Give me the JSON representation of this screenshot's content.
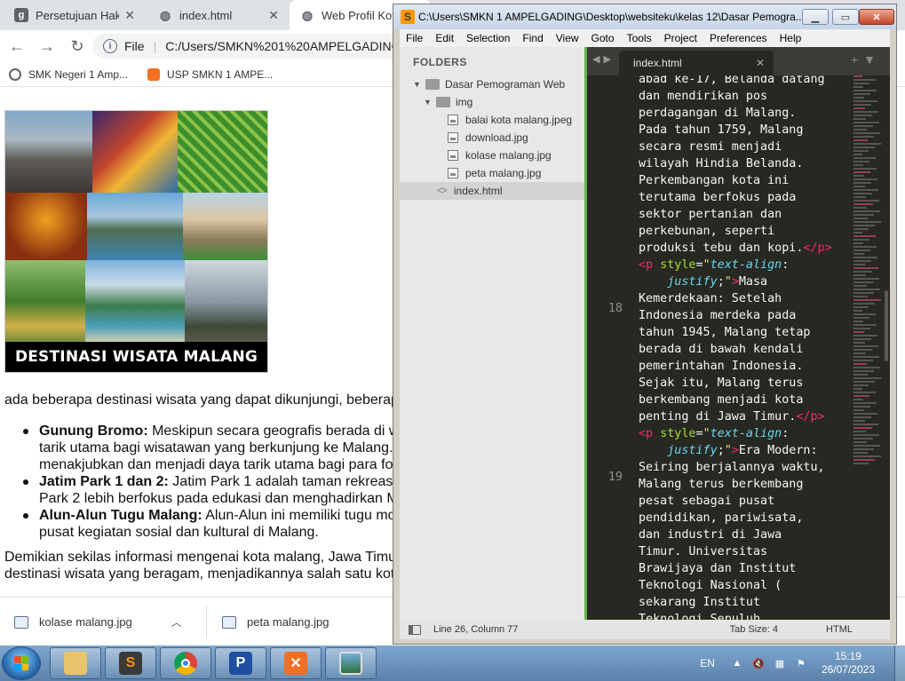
{
  "browser": {
    "tabs": [
      {
        "title": "Persetujuan Hak C",
        "favicon": "docs-icon",
        "color": "#5f6368",
        "active": false
      },
      {
        "title": "index.html",
        "favicon": "globe-icon",
        "color": "#5f6368",
        "active": false
      },
      {
        "title": "Web Profil Kota",
        "favicon": "globe-icon",
        "color": "#5f6368",
        "active": true
      }
    ],
    "address": {
      "prefix": "File",
      "url": "C:/Users/SMKN%201%20AMPELGADING/D"
    },
    "bookmarks": [
      {
        "label": "SMK Negeri 1 Amp...",
        "icon": "globe-icon"
      },
      {
        "label": "USP SMKN 1 AMPE...",
        "icon": "xampp-icon"
      }
    ]
  },
  "page": {
    "collage_caption": "DESTINASI WISATA MALANG",
    "intro": "ada beberapa destinasi wisata yang dapat dikunjungi, beberap",
    "destinations": [
      {
        "name": "Gunung Bromo:",
        "text": " Meskipun secara geografis berada di wi",
        "cont": [
          "tarik utama bagi wisatawan yang berkunjung ke Malang.",
          "menakjubkan dan menjadi daya tarik utama bagi para fo"
        ]
      },
      {
        "name": "Jatim Park 1 dan 2:",
        "text": " Jatim Park 1 adalah taman rekreas",
        "cont": [
          "Park 2 lebih berfokus pada edukasi dan menghadirkan M"
        ]
      },
      {
        "name": "Alun-Alun Tugu Malang:",
        "text": " Alun-Alun ini memiliki tugu mo",
        "cont": [
          "pusat kegiatan sosial dan kultural di Malang."
        ]
      }
    ],
    "outro": [
      "Demikian sekilas informasi mengenai kota malang, Jawa Timu",
      "destinasi wisata yang beragam, menjadikannya salah satu kot"
    ]
  },
  "downloads": [
    {
      "name": "kolase malang.jpg"
    },
    {
      "name": "peta malang.jpg"
    }
  ],
  "sublime": {
    "title": "C:\\Users\\SMKN 1 AMPELGADING\\Desktop\\websiteku\\kelas 12\\Dasar Pemogra...",
    "menu": [
      "File",
      "Edit",
      "Selection",
      "Find",
      "View",
      "Goto",
      "Tools",
      "Project",
      "Preferences",
      "Help"
    ],
    "sidebar": {
      "heading": "FOLDERS",
      "root": "Dasar Pemograman Web",
      "folder": "img",
      "files": [
        "balai kota malang.jpeg",
        "download.jpg",
        "kolase malang.jpg",
        "peta malang.jpg"
      ],
      "root_file": "index.html"
    },
    "tab": "index.html",
    "status": {
      "position": "Line 26, Column 77",
      "tab_size": "Tab Size: 4",
      "syntax": "HTML"
    }
  },
  "taskbar": {
    "apps": [
      "explorer",
      "sublime",
      "chrome",
      "p-app",
      "xampp",
      "image-viewer"
    ],
    "lang": "EN",
    "time": "15:19",
    "date": "26/07/2023"
  }
}
